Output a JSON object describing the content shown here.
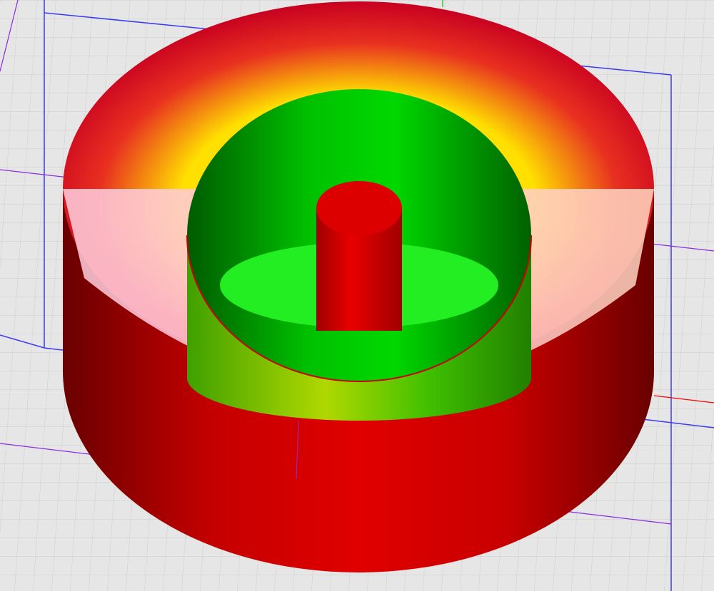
{
  "viewport": {
    "background_color": "#e6e6e6",
    "grid_color": "#cfcfcf",
    "bounding_box_color": "#3a3af0",
    "axis_colors": {
      "x": "#ff0000",
      "y": "#00cc00",
      "z": "#8a2be2"
    }
  },
  "model": {
    "outer_cylinder_color": "#dd0000",
    "inner_cavity_color": "#00dd00",
    "center_pin_color": "#dd0000",
    "highlight_color": "#ffff00"
  }
}
